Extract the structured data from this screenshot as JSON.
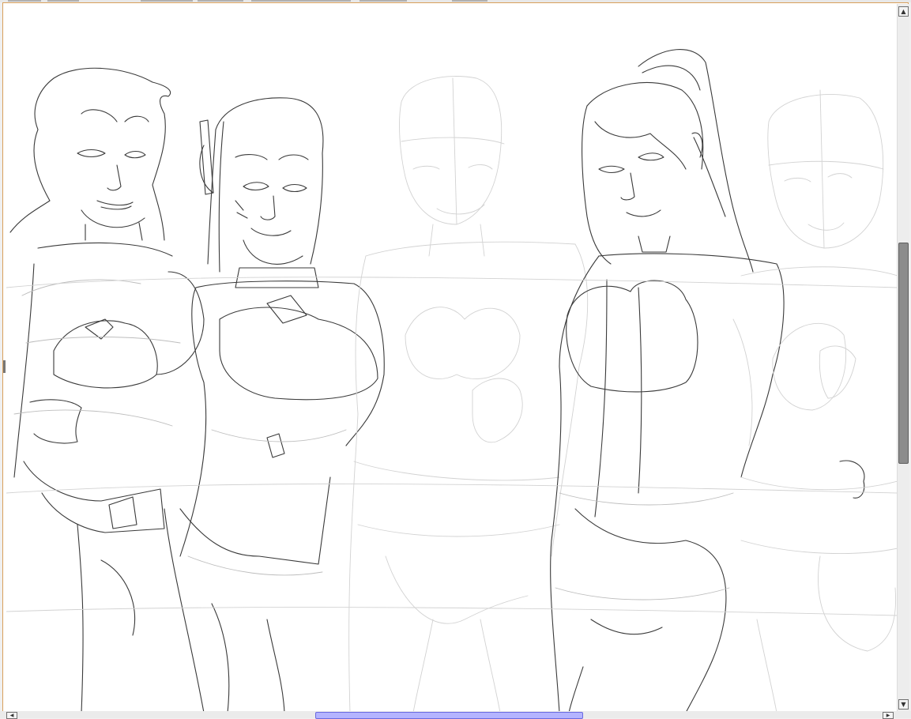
{
  "window": {
    "accent_border": "#d9a05b",
    "canvas_background": "#ffffff"
  },
  "scrollbars": {
    "vertical": {
      "up_icon": "triangle-up-icon",
      "down_icon": "triangle-down-icon",
      "up_glyph": "▲",
      "down_glyph": "▼"
    },
    "horizontal": {
      "left_icon": "triangle-left-icon",
      "right_icon": "triangle-right-icon",
      "left_glyph": "◀",
      "right_glyph": "▶",
      "thumb_color": "#b4b4ff"
    }
  },
  "artwork": {
    "description_kind": "line-art-sketch",
    "figures": [
      "inked-figure-1",
      "inked-figure-2",
      "sketch-figure-3",
      "inked-figure-4",
      "sketch-figure-5"
    ]
  }
}
